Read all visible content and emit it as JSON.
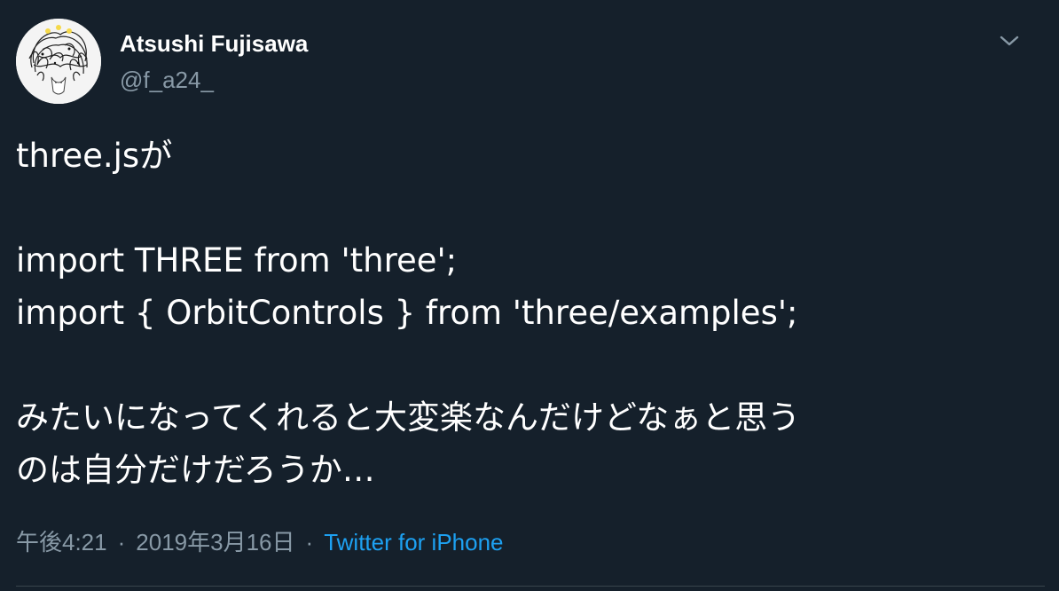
{
  "author": {
    "name": "Atsushi Fujisawa",
    "handle": "@f_a24_",
    "avatar_icon": "avatar-illustration"
  },
  "menu": {
    "icon": "chevron-down-icon"
  },
  "tweet": {
    "lines": [
      "three.jsが",
      "",
      "import THREE from 'three';",
      "import { OrbitControls } from 'three/examples';",
      "",
      "みたいになってくれると大変楽なんだけどなぁと思う",
      "のは自分だけだろうか…"
    ]
  },
  "meta": {
    "time": "午後4:21",
    "separator": "·",
    "date": "2019年3月16日",
    "source": "Twitter for iPhone"
  },
  "colors": {
    "background": "#15202b",
    "text": "#ffffff",
    "secondary": "#8899a6",
    "accent": "#1da1f2",
    "divider": "#38444d"
  }
}
